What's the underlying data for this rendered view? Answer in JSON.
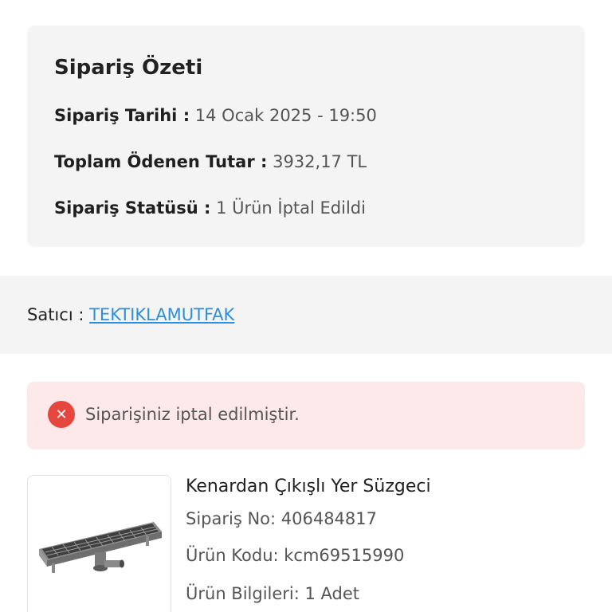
{
  "summary": {
    "title": "Sipariş Özeti",
    "order_date_label": "Sipariş Tarihi :",
    "order_date_value": "14 Ocak 2025 - 19:50",
    "total_label": "Toplam Ödenen Tutar :",
    "total_value": "3932,17 TL",
    "status_label": "Sipariş Statüsü :",
    "status_value": "1 Ürün İptal Edildi"
  },
  "seller": {
    "label": "Satıcı :",
    "name": "TEKTIKLAMUTFAK"
  },
  "alert": {
    "icon": "close-circle-icon",
    "icon_glyph": "✕",
    "message": "Siparişiniz iptal edilmiştir.",
    "color": "#e5473f",
    "background": "#fde9e9"
  },
  "product": {
    "name": "Kenardan Çıkışlı Yer Süzgeci",
    "order_no": "Sipariş No: 406484817",
    "code": "Ürün Kodu: kcm69515990",
    "info": "Ürün Bilgileri: 1 Adet"
  },
  "colors": {
    "link": "#2d8fe0",
    "card_background": "#f4f4f4"
  }
}
